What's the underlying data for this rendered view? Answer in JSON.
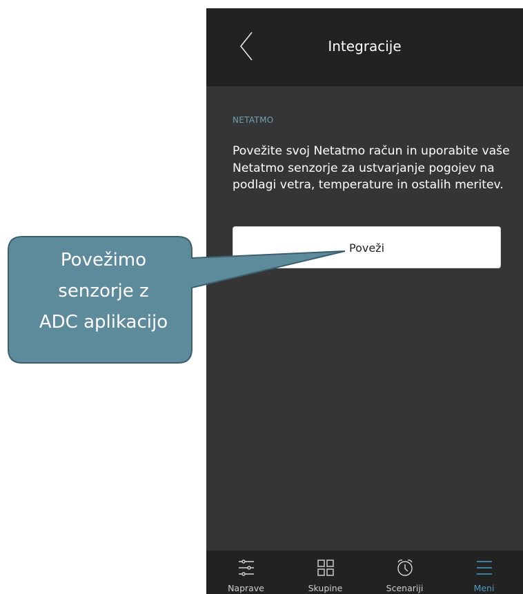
{
  "header": {
    "title": "Integracije",
    "back_icon": "chevron-left-icon"
  },
  "section": {
    "label": "NETATMO",
    "description": "Povežite svoj Netatmo račun in uporabite vaše Netatmo senzorje za ustvarjanje pogojev na podlagi vetra, temperature in ostalih meritev.",
    "connect_label": "Poveži"
  },
  "tabs": [
    {
      "label": "Naprave",
      "icon": "sliders-icon",
      "active": false
    },
    {
      "label": "Skupine",
      "icon": "grid-icon",
      "active": false
    },
    {
      "label": "Scenariji",
      "icon": "alarm-clock-icon",
      "active": false
    },
    {
      "label": "Meni",
      "icon": "menu-icon",
      "active": true
    }
  ],
  "callout": {
    "line1": "Povežimo",
    "line2": "senzorje z",
    "line3": "ADC aplikacijo"
  },
  "colors": {
    "header_bg": "#222222",
    "content_bg": "#353535",
    "accent": "#4f9cc7",
    "callout_fill": "#5e8b9b"
  }
}
